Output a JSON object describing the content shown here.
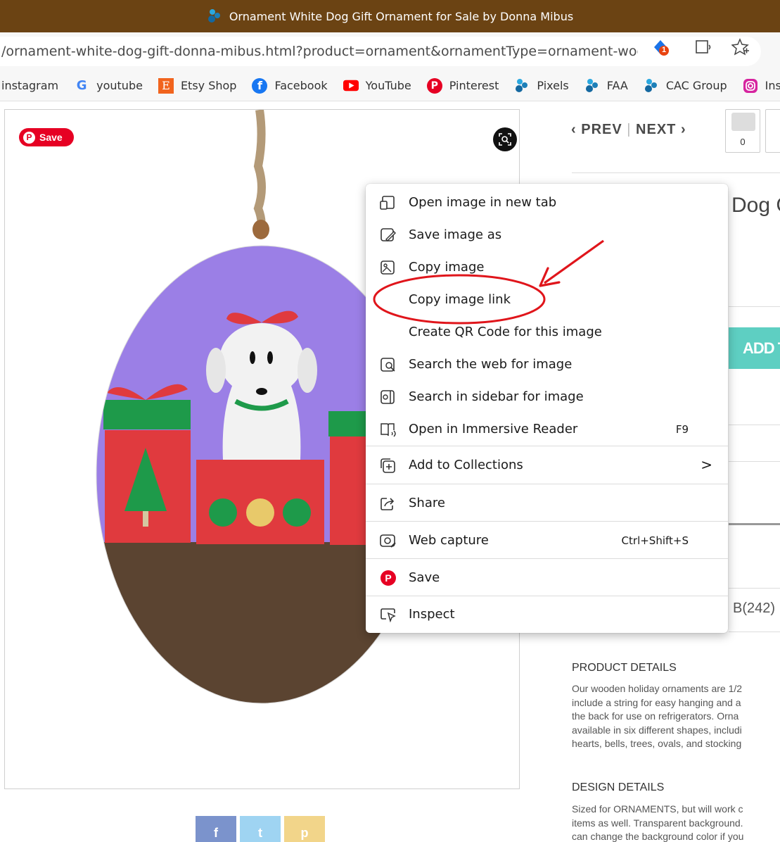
{
  "window": {
    "title": "Ornament White Dog Gift Ornament for Sale by Donna Mibus"
  },
  "address": {
    "url": "/ornament-white-dog-gift-donna-mibus.html?product=ornament&ornamentType=ornament-woo...",
    "notification_count": "1"
  },
  "bookmarks": [
    {
      "label": "instagram",
      "icon": "instagram-icon"
    },
    {
      "label": "youtube",
      "icon": "google-icon"
    },
    {
      "label": "Etsy Shop",
      "icon": "etsy-icon"
    },
    {
      "label": "Facebook",
      "icon": "facebook-icon"
    },
    {
      "label": "YouTube",
      "icon": "youtube-icon"
    },
    {
      "label": "Pinterest",
      "icon": "pinterest-icon"
    },
    {
      "label": "Pixels",
      "icon": "pixels-icon"
    },
    {
      "label": "FAA",
      "icon": "pixels-icon"
    },
    {
      "label": "CAC Group",
      "icon": "pixels-icon"
    },
    {
      "label": "Ins",
      "icon": "instagram-icon"
    }
  ],
  "product_image": {
    "save_label": "Save"
  },
  "nav": {
    "prev": "PREV",
    "separator": "|",
    "next": "NEXT",
    "comment_count": "0"
  },
  "product": {
    "title_partial": "Dog G",
    "add_to_cart_partial": "ADD TO",
    "color_value": "B(242)"
  },
  "details": {
    "product_heading": "PRODUCT DETAILS",
    "product_lines": [
      "Our wooden holiday ornaments are 1/2",
      "include a string for easy hanging and a",
      "the back for use on refrigerators.   Orna",
      "available in six different shapes, includi",
      "hearts, bells, trees, ovals, and stocking"
    ],
    "design_heading": "DESIGN DETAILS",
    "design_lines": [
      "Sized for ORNAMENTS, but will work c",
      "items as well. Transparent background.",
      "can change the background color if you"
    ]
  },
  "social": {
    "facebook": "f",
    "twitter": "t",
    "pinterest": "p"
  },
  "context_menu": {
    "items": [
      {
        "label": "Open image in new tab",
        "icon": "open-new-tab-icon",
        "shortcut": ""
      },
      {
        "label": "Save image as",
        "icon": "save-image-icon",
        "shortcut": ""
      },
      {
        "label": "Copy image",
        "icon": "copy-image-icon",
        "shortcut": ""
      },
      {
        "label": "Copy image link",
        "icon": "",
        "shortcut": ""
      },
      {
        "label": "Create QR Code for this image",
        "icon": "",
        "shortcut": ""
      },
      {
        "label": "Search the web for image",
        "icon": "visual-search-icon",
        "shortcut": ""
      },
      {
        "label": "Search in sidebar for image",
        "icon": "sidebar-search-icon",
        "shortcut": ""
      },
      {
        "label": "Open in Immersive Reader",
        "icon": "immersive-reader-icon",
        "shortcut": "F9"
      },
      {
        "label": "Add to Collections",
        "icon": "collections-icon",
        "shortcut": "",
        "submenu": ">"
      },
      {
        "label": "Share",
        "icon": "share-icon",
        "shortcut": ""
      },
      {
        "label": "Web capture",
        "icon": "web-capture-icon",
        "shortcut": "Ctrl+Shift+S"
      },
      {
        "label": "Save",
        "icon": "pinterest-icon",
        "shortcut": ""
      },
      {
        "label": "Inspect",
        "icon": "inspect-icon",
        "shortcut": ""
      }
    ]
  },
  "colors": {
    "title_bar": "#6b4313",
    "annotation_red": "#e0151b",
    "ornament_purple": "#9b7fe6",
    "ornament_wood": "#5b4431",
    "add_button": "#5ecfc2",
    "pinterest_red": "#e60023"
  }
}
